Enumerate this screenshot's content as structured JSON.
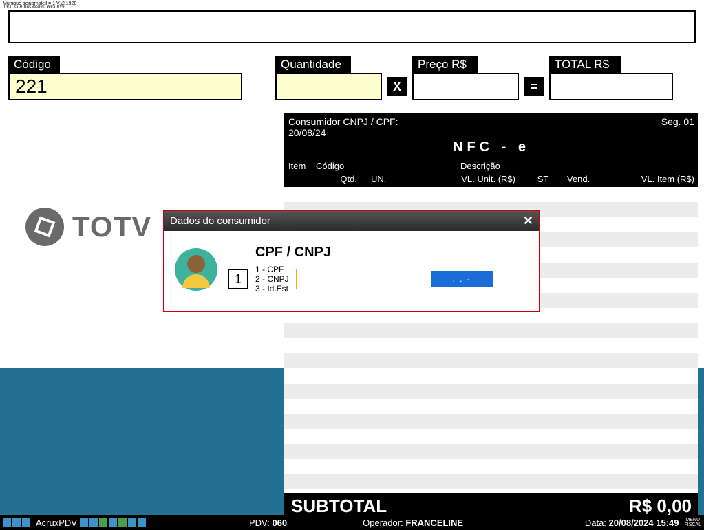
{
  "window": {
    "title": "Munique acjuornalell = 1 V.\\2.1920",
    "subtitle": "mex: tsteinacessiel: westeve"
  },
  "fields": {
    "codigo": {
      "label": "Código",
      "value": "221"
    },
    "quantidade": {
      "label": "Quantidade",
      "value": ""
    },
    "preco": {
      "label": "Preço R$",
      "value": ""
    },
    "total": {
      "label": "TOTAL R$",
      "value": ""
    }
  },
  "operators": {
    "multiply": "X",
    "equals": "="
  },
  "logo": {
    "text": "TOTV"
  },
  "grid": {
    "consumer_label": "Consumidor CNPJ / CPF:",
    "date": "20/08/24",
    "seg": "Seg. 01",
    "nfce": "NFC - e",
    "cols": {
      "item": "Item",
      "codigo": "Código",
      "qtd": "Qtd.",
      "un": "UN.",
      "descricao": "Descrição",
      "vlunit": "VL. Unit. (R$)",
      "st": "ST",
      "vend": "Vend.",
      "vlitem": "VL. Item (R$)"
    }
  },
  "subtotal": {
    "label": "SUBTOTAL",
    "value": "R$ 0,00"
  },
  "status": {
    "product": "AcruxPDV",
    "pdv_label": "PDV:",
    "pdv_value": "060",
    "operator_label": "Operador:",
    "operator_value": "FRANCELINE",
    "date_label": "Data:",
    "date_value": "20/08/2024 15:49",
    "menu": "MENU\nFISCAL"
  },
  "modal": {
    "title": "Dados do consumidor",
    "heading": "CPF / CNPJ",
    "type_value": "1",
    "options": {
      "opt1": "1 - CPF",
      "opt2": "2 - CNPJ",
      "opt3": "3 - Id.Est"
    },
    "mask": ".   .   -"
  }
}
